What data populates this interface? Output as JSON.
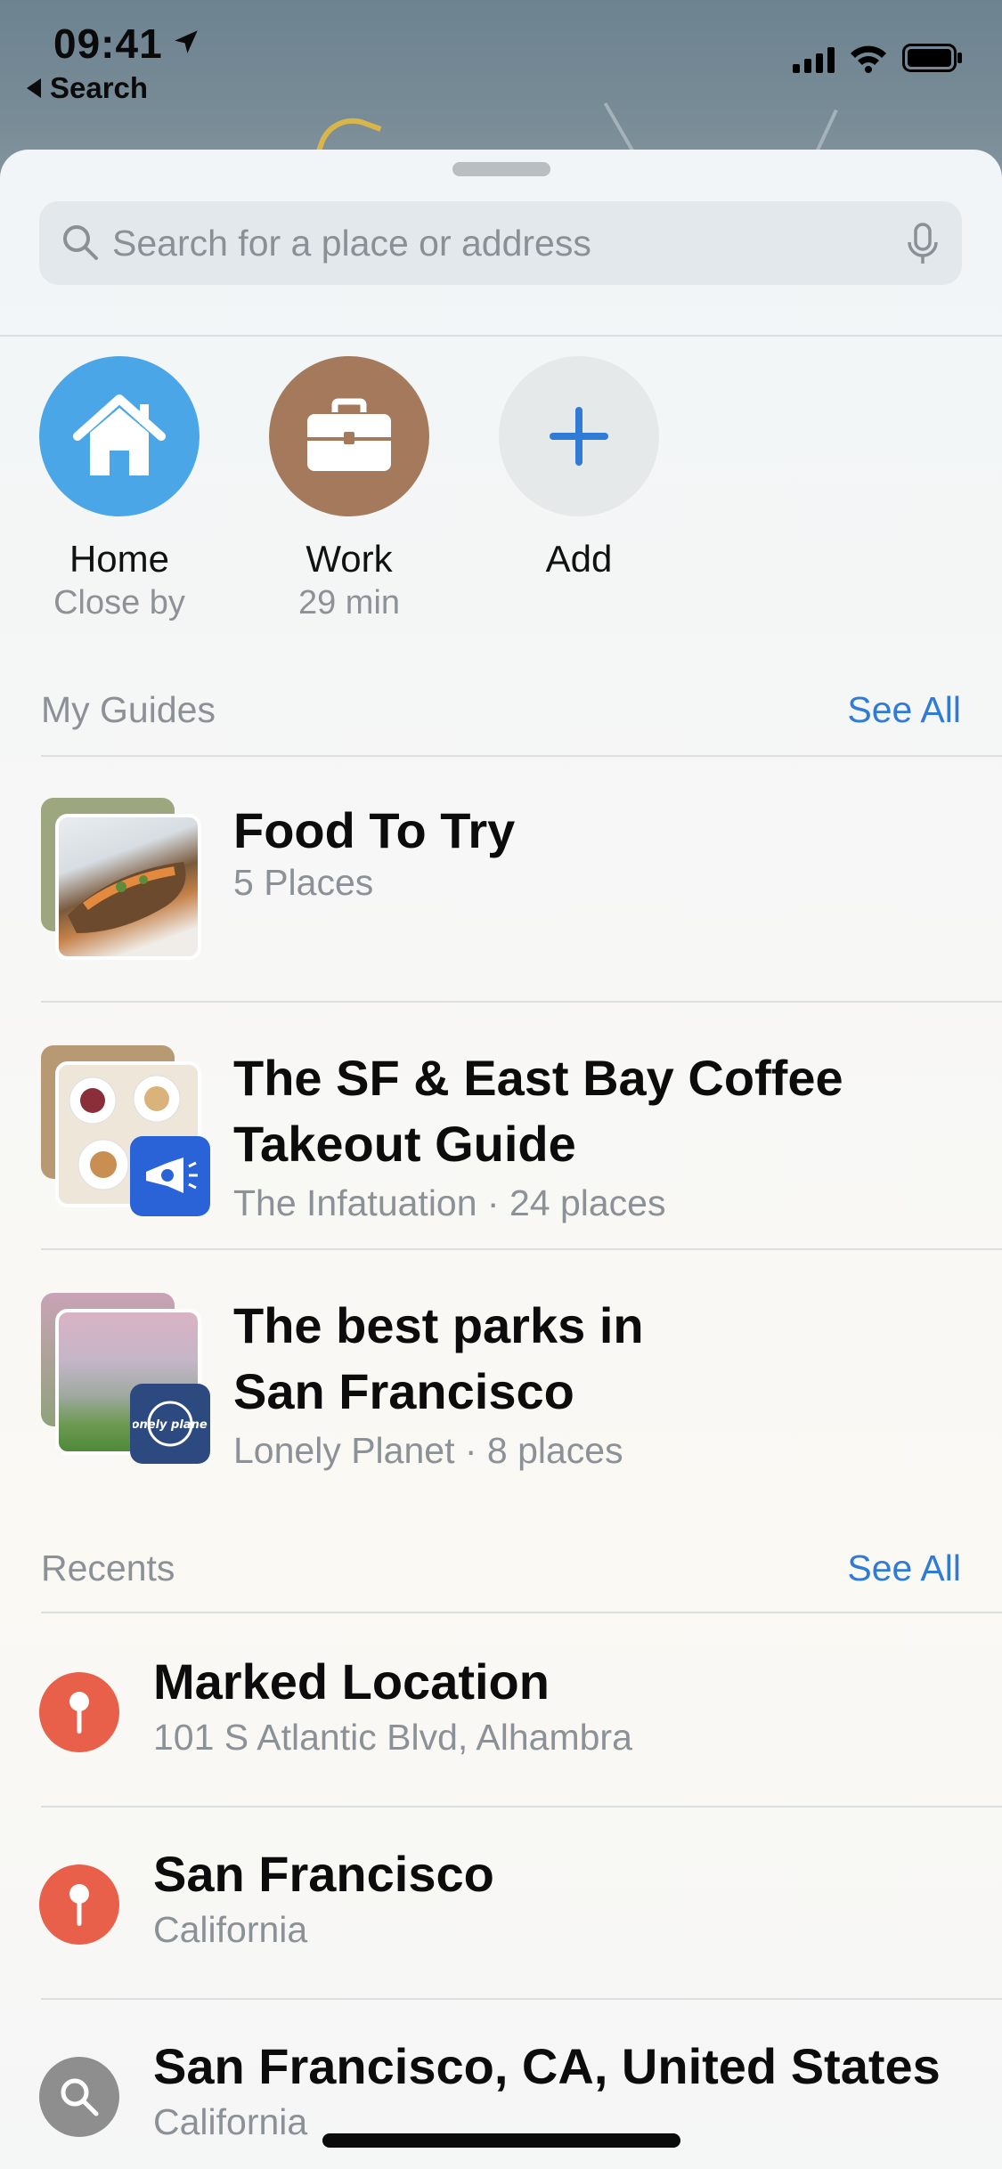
{
  "status_bar": {
    "time": "09:41",
    "back_label": "Search"
  },
  "search": {
    "placeholder": "Search for a place or address"
  },
  "favorites": [
    {
      "title": "Home",
      "subtitle": "Close by",
      "icon": "house-icon",
      "color": "#4aa6e6"
    },
    {
      "title": "Work",
      "subtitle": "29 min",
      "icon": "briefcase-icon",
      "color": "#a4795c"
    },
    {
      "title": "Add",
      "subtitle": "",
      "icon": "plus-icon",
      "color": "#e6e9ea"
    }
  ],
  "guides_section": {
    "title": "My Guides",
    "see_all": "See All",
    "items": [
      {
        "title_lines": [
          "Food To Try"
        ],
        "subtitle": "5 Places"
      },
      {
        "title_lines": [
          "The SF & East Bay Coffee",
          "Takeout Guide"
        ],
        "subtitle": "The Infatuation · 24 places"
      },
      {
        "title_lines": [
          "The best parks in",
          "San Francisco"
        ],
        "subtitle": "Lonely Planet · 8 places",
        "badge_text": "lonely planet"
      }
    ]
  },
  "recents_section": {
    "title": "Recents",
    "see_all": "See All",
    "items": [
      {
        "title": "Marked Location",
        "subtitle": "101 S Atlantic Blvd, Alhambra",
        "icon": "pin-icon"
      },
      {
        "title": "San Francisco",
        "subtitle": "California",
        "icon": "pin-icon"
      },
      {
        "title": "San Francisco, CA, United States",
        "subtitle": "California",
        "icon": "magnifier-icon"
      }
    ]
  },
  "colors": {
    "accent": "#2f7bd6",
    "pin_red": "#e8604a",
    "search_gray": "#8e8e8e",
    "infatuation_blue": "#2a63d8",
    "lonely_planet_navy": "#2c4a80"
  }
}
